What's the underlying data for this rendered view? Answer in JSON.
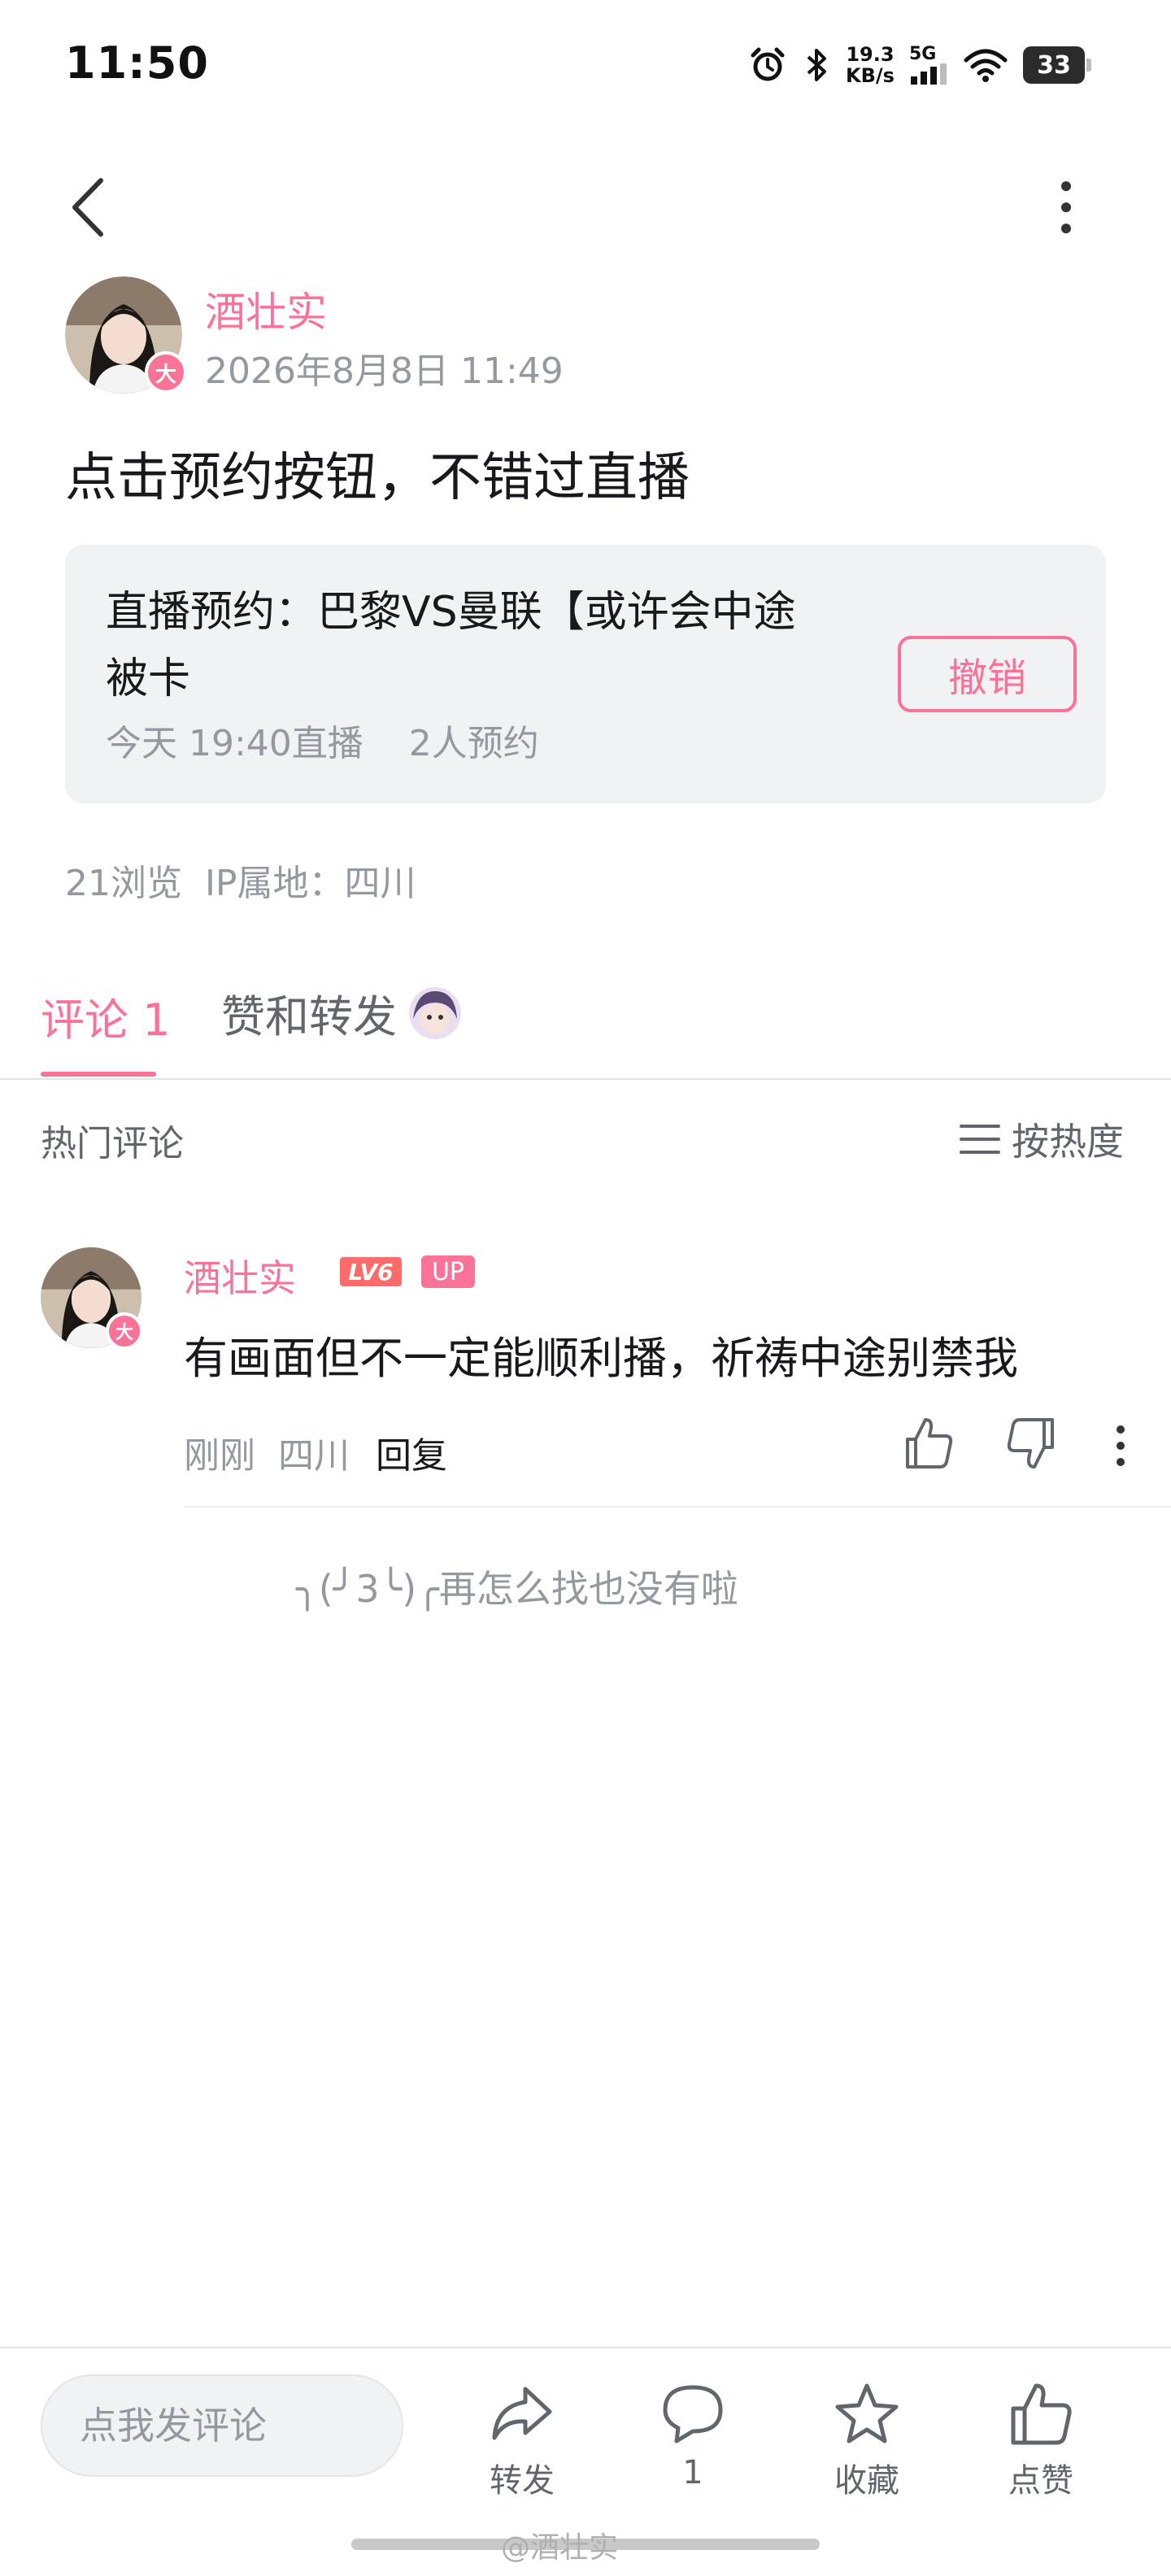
{
  "status_bar": {
    "time": "11:50",
    "net_speed_value": "19.3",
    "net_speed_unit": "KB/s",
    "network_type": "5G",
    "battery": "33",
    "icons": [
      "alarm-icon",
      "bluetooth-icon",
      "signal-icon",
      "wifi-icon",
      "battery-icon"
    ]
  },
  "post": {
    "author": "酒壮实",
    "time": "2026年8月8日 11:49",
    "avatar_badge": "大",
    "text": "点击预约按钮，不错过直播",
    "reservation": {
      "title": "直播预约：巴黎VS曼联【或许会中途被卡",
      "meta": "今天 19:40直播    2人预约",
      "button_label": "撤销"
    },
    "stats": "21浏览  IP属地：四川"
  },
  "tabs": {
    "comments": "评论 1",
    "likes_shares": "赞和转发"
  },
  "comments_section": {
    "hot_label": "热门评论",
    "sort_label": "按热度",
    "items": [
      {
        "author": "酒壮实",
        "level": "LV6",
        "up_badge": "UP",
        "avatar_badge": "大",
        "text": "有画面但不一定能顺利播，祈祷中途别禁我",
        "meta": "刚刚  四川",
        "reply_label": "回复"
      }
    ],
    "end_text": "╮(╯3╰)╭再怎么找也没有啦"
  },
  "bottom_bar": {
    "input_placeholder": "点我发评论",
    "share_label": "转发",
    "comment_count": "1",
    "favorite_label": "收藏",
    "like_label": "点赞"
  },
  "watermark": "@酒壮实",
  "colors": {
    "accent": "#fb7299",
    "text_primary": "#18191c",
    "text_secondary": "#9499a0",
    "card_bg": "#f1f2f3"
  }
}
